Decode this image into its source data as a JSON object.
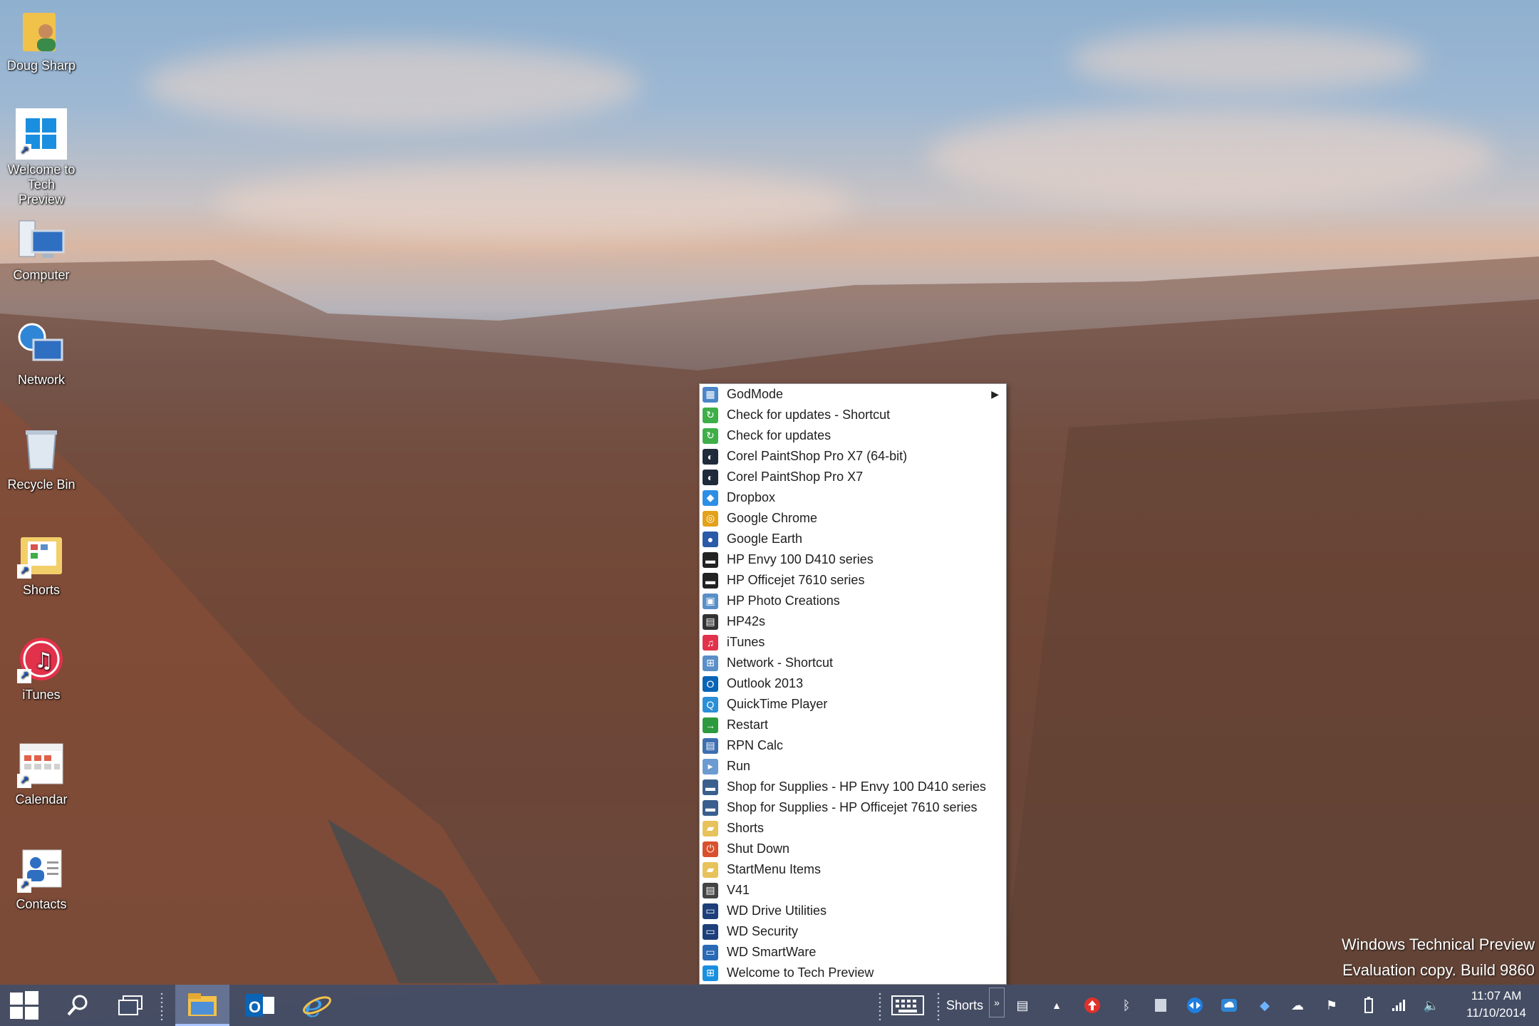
{
  "desktop": {
    "icons": [
      {
        "label": "Doug Sharp",
        "icon": "user-folder-icon"
      },
      {
        "label": "Welcome to Tech Preview",
        "icon": "windows-logo-icon"
      },
      {
        "label": "Computer",
        "icon": "computer-icon"
      },
      {
        "label": "Network",
        "icon": "network-icon"
      },
      {
        "label": "Recycle Bin",
        "icon": "recycle-bin-icon"
      },
      {
        "label": "Shorts",
        "icon": "folder-icon"
      },
      {
        "label": "iTunes",
        "icon": "itunes-icon"
      },
      {
        "label": "Calendar",
        "icon": "calendar-icon"
      },
      {
        "label": "Contacts",
        "icon": "contacts-icon"
      }
    ]
  },
  "menu": {
    "items": [
      {
        "label": "GodMode",
        "icon": "control-panel-icon",
        "color": "#4a86c8",
        "submenu": true
      },
      {
        "label": "Check for updates - Shortcut",
        "icon": "update-icon",
        "color": "#3fae49"
      },
      {
        "label": "Check for updates",
        "icon": "update-icon",
        "color": "#3fae49"
      },
      {
        "label": "Corel PaintShop Pro X7 (64-bit)",
        "icon": "paintshop-icon",
        "color": "#1f2a3a"
      },
      {
        "label": "Corel PaintShop Pro X7",
        "icon": "paintshop-icon",
        "color": "#1f2a3a"
      },
      {
        "label": "Dropbox",
        "icon": "dropbox-icon",
        "color": "#2d8ee6"
      },
      {
        "label": "Google Chrome",
        "icon": "chrome-icon",
        "color": "#e3a21a"
      },
      {
        "label": "Google Earth",
        "icon": "google-earth-icon",
        "color": "#2a5aa8"
      },
      {
        "label": "HP Envy 100 D410 series",
        "icon": "printer-icon",
        "color": "#222222"
      },
      {
        "label": "HP Officejet 7610 series",
        "icon": "printer-icon",
        "color": "#222222"
      },
      {
        "label": "HP Photo Creations",
        "icon": "photo-icon",
        "color": "#5b8fc7"
      },
      {
        "label": "HP42s",
        "icon": "calculator-icon",
        "color": "#333333"
      },
      {
        "label": "iTunes",
        "icon": "itunes-icon",
        "color": "#e2314a"
      },
      {
        "label": "Network - Shortcut",
        "icon": "network-icon",
        "color": "#5b8fc7"
      },
      {
        "label": "Outlook 2013",
        "icon": "outlook-icon",
        "color": "#0a64b6"
      },
      {
        "label": "QuickTime Player",
        "icon": "quicktime-icon",
        "color": "#2b8fd8"
      },
      {
        "label": "Restart",
        "icon": "restart-icon",
        "color": "#2e9a3e"
      },
      {
        "label": "RPN Calc",
        "icon": "calculator-icon",
        "color": "#3d6fb0"
      },
      {
        "label": "Run",
        "icon": "run-icon",
        "color": "#6b9bd0"
      },
      {
        "label": "Shop for Supplies - HP Envy 100 D410 series",
        "icon": "printer-icon",
        "color": "#3a5f8f"
      },
      {
        "label": "Shop for Supplies - HP Officejet 7610 series",
        "icon": "printer-icon",
        "color": "#3a5f8f"
      },
      {
        "label": "Shorts",
        "icon": "folder-icon",
        "color": "#e8c25a"
      },
      {
        "label": "Shut Down",
        "icon": "power-icon",
        "color": "#d9512c"
      },
      {
        "label": "StartMenu Items",
        "icon": "folder-icon",
        "color": "#e8c25a"
      },
      {
        "label": "V41",
        "icon": "calculator-icon",
        "color": "#444444"
      },
      {
        "label": "WD Drive Utilities",
        "icon": "drive-icon",
        "color": "#1d3f7a"
      },
      {
        "label": "WD Security",
        "icon": "drive-icon",
        "color": "#1d3f7a"
      },
      {
        "label": "WD SmartWare",
        "icon": "drive-icon",
        "color": "#2a6ab5"
      },
      {
        "label": "Welcome to Tech Preview",
        "icon": "windows-logo-icon",
        "color": "#1a8fe0"
      }
    ]
  },
  "watermark": {
    "line1": "Windows Technical Preview",
    "line2": "Evaluation copy. Build 9860"
  },
  "taskbar": {
    "toolbar_label": "Shorts",
    "pinned": [
      "start-icon",
      "search-icon",
      "task-view-icon",
      "file-explorer-icon",
      "outlook-icon",
      "internet-explorer-icon"
    ],
    "clock_time": "11:07 AM",
    "clock_date": "11/10/2014"
  }
}
